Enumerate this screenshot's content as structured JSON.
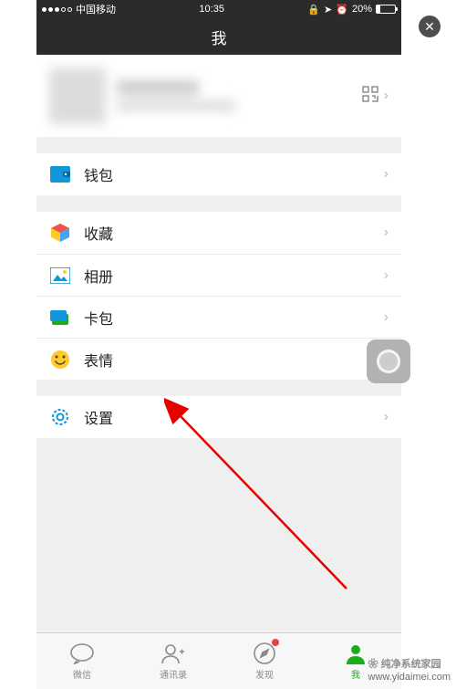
{
  "status": {
    "carrier": "中国移动",
    "time": "10:35",
    "battery": "20%"
  },
  "nav": {
    "title": "我"
  },
  "menu": {
    "wallet": "钱包",
    "favorites": "收藏",
    "album": "相册",
    "cards": "卡包",
    "stickers": "表情",
    "settings": "设置"
  },
  "tabs": {
    "chats": "微信",
    "contacts": "通讯录",
    "discover": "发现",
    "me": "我"
  },
  "watermark": {
    "brand": "纯净系统家园",
    "url": "www.yidaimei.com"
  }
}
